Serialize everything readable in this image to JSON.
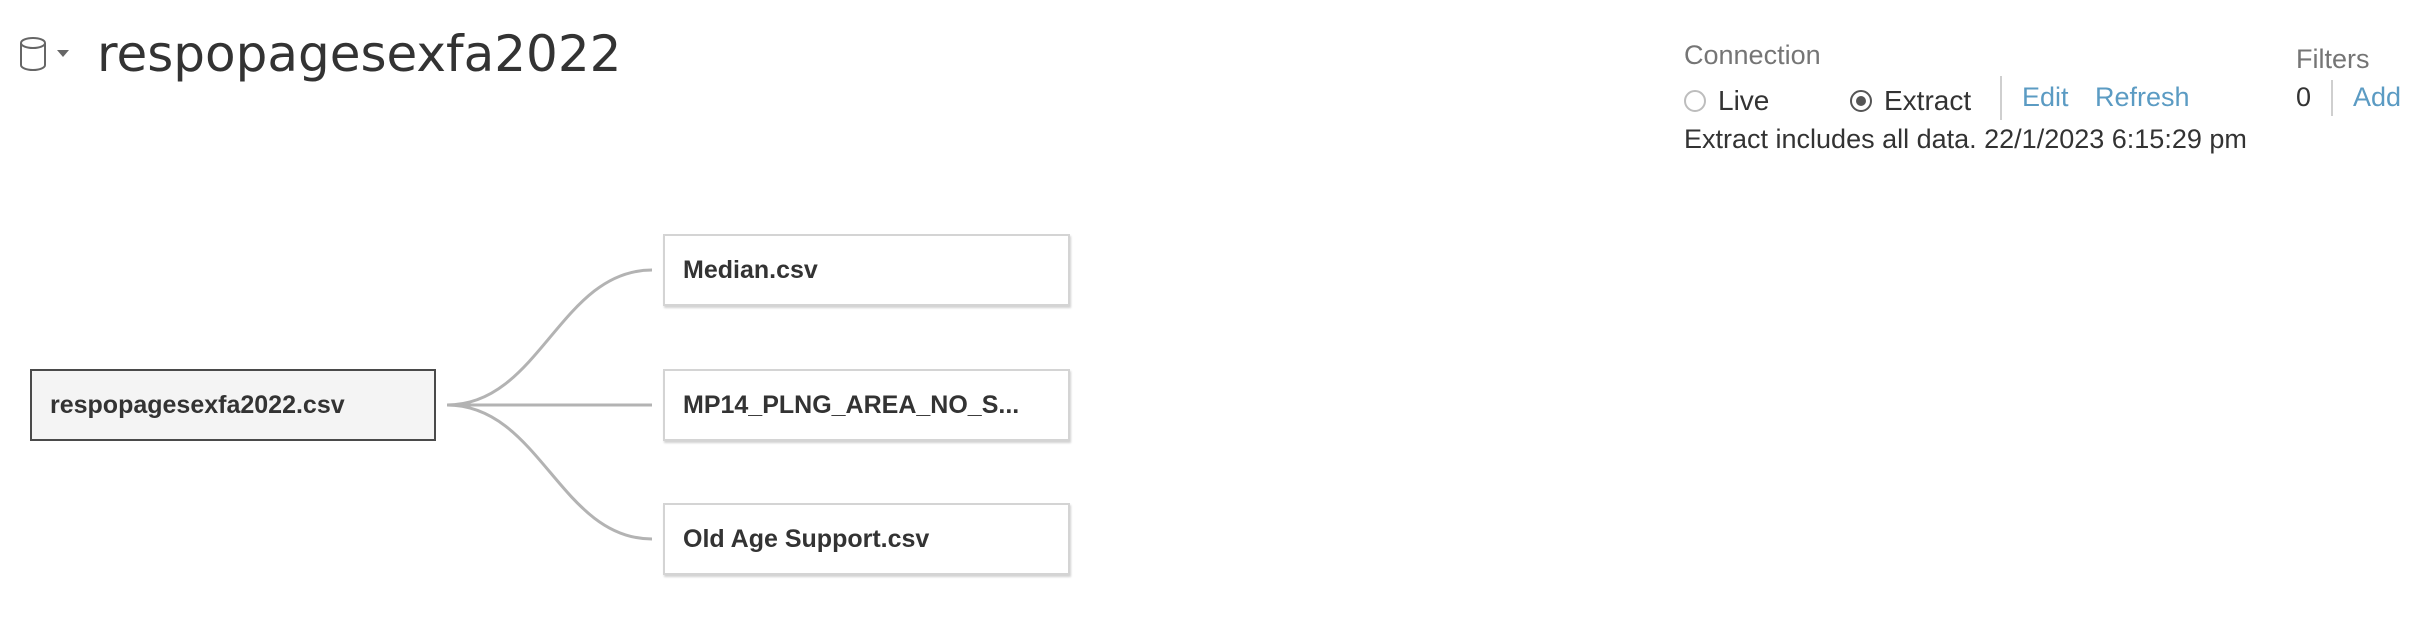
{
  "datasource": {
    "icon": "database-icon",
    "title": "respopagesexfa2022"
  },
  "connection": {
    "label": "Connection",
    "live_label": "Live",
    "extract_label": "Extract",
    "selected": "Extract",
    "edit_label": "Edit",
    "refresh_label": "Refresh",
    "extract_info": "Extract includes all data. 22/1/2023 6:15:29 pm"
  },
  "filters": {
    "label": "Filters",
    "count": "0",
    "add_label": "Add"
  },
  "join_canvas": {
    "root_table": "respopagesexfa2022.csv",
    "related_tables": [
      {
        "label": "Median.csv"
      },
      {
        "label": "MP14_PLNG_AREA_NO_S..."
      },
      {
        "label": "Old Age Support.csv"
      }
    ]
  },
  "colors": {
    "link": "#5b9bc3",
    "text": "#333333",
    "muted": "#757575",
    "connector": "#b3b3b3"
  }
}
